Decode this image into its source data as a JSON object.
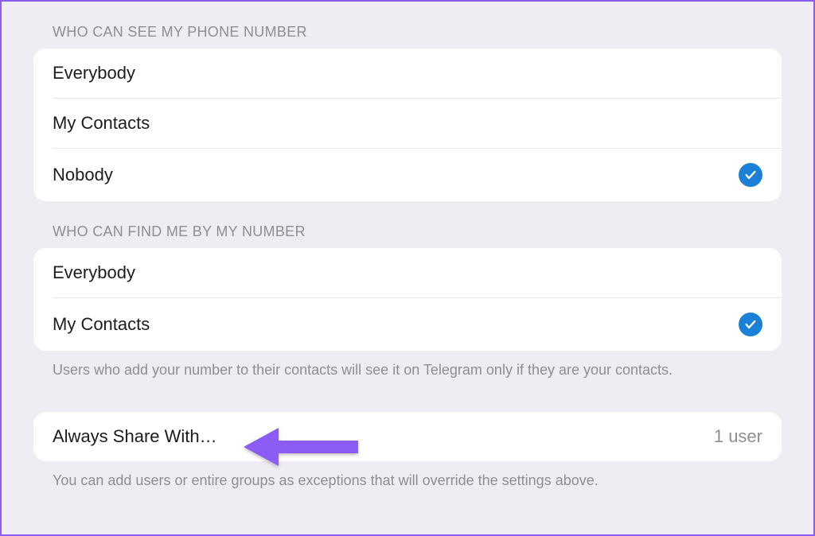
{
  "sections": {
    "seePhone": {
      "header": "WHO CAN SEE MY PHONE NUMBER",
      "options": {
        "everybody": "Everybody",
        "myContacts": "My Contacts",
        "nobody": "Nobody"
      },
      "selected": "nobody"
    },
    "findByNumber": {
      "header": "WHO CAN FIND ME BY MY NUMBER",
      "options": {
        "everybody": "Everybody",
        "myContacts": "My Contacts"
      },
      "selected": "myContacts",
      "footer": "Users who add your number to their contacts will see it on Telegram only if they are your contacts."
    },
    "exceptions": {
      "alwaysShareLabel": "Always Share With…",
      "alwaysShareValue": "1 user",
      "footer": "You can add users or entire groups as exceptions that will override the settings above."
    }
  },
  "colors": {
    "accent": "#1b81d6",
    "annotation": "#8b5cf6"
  }
}
